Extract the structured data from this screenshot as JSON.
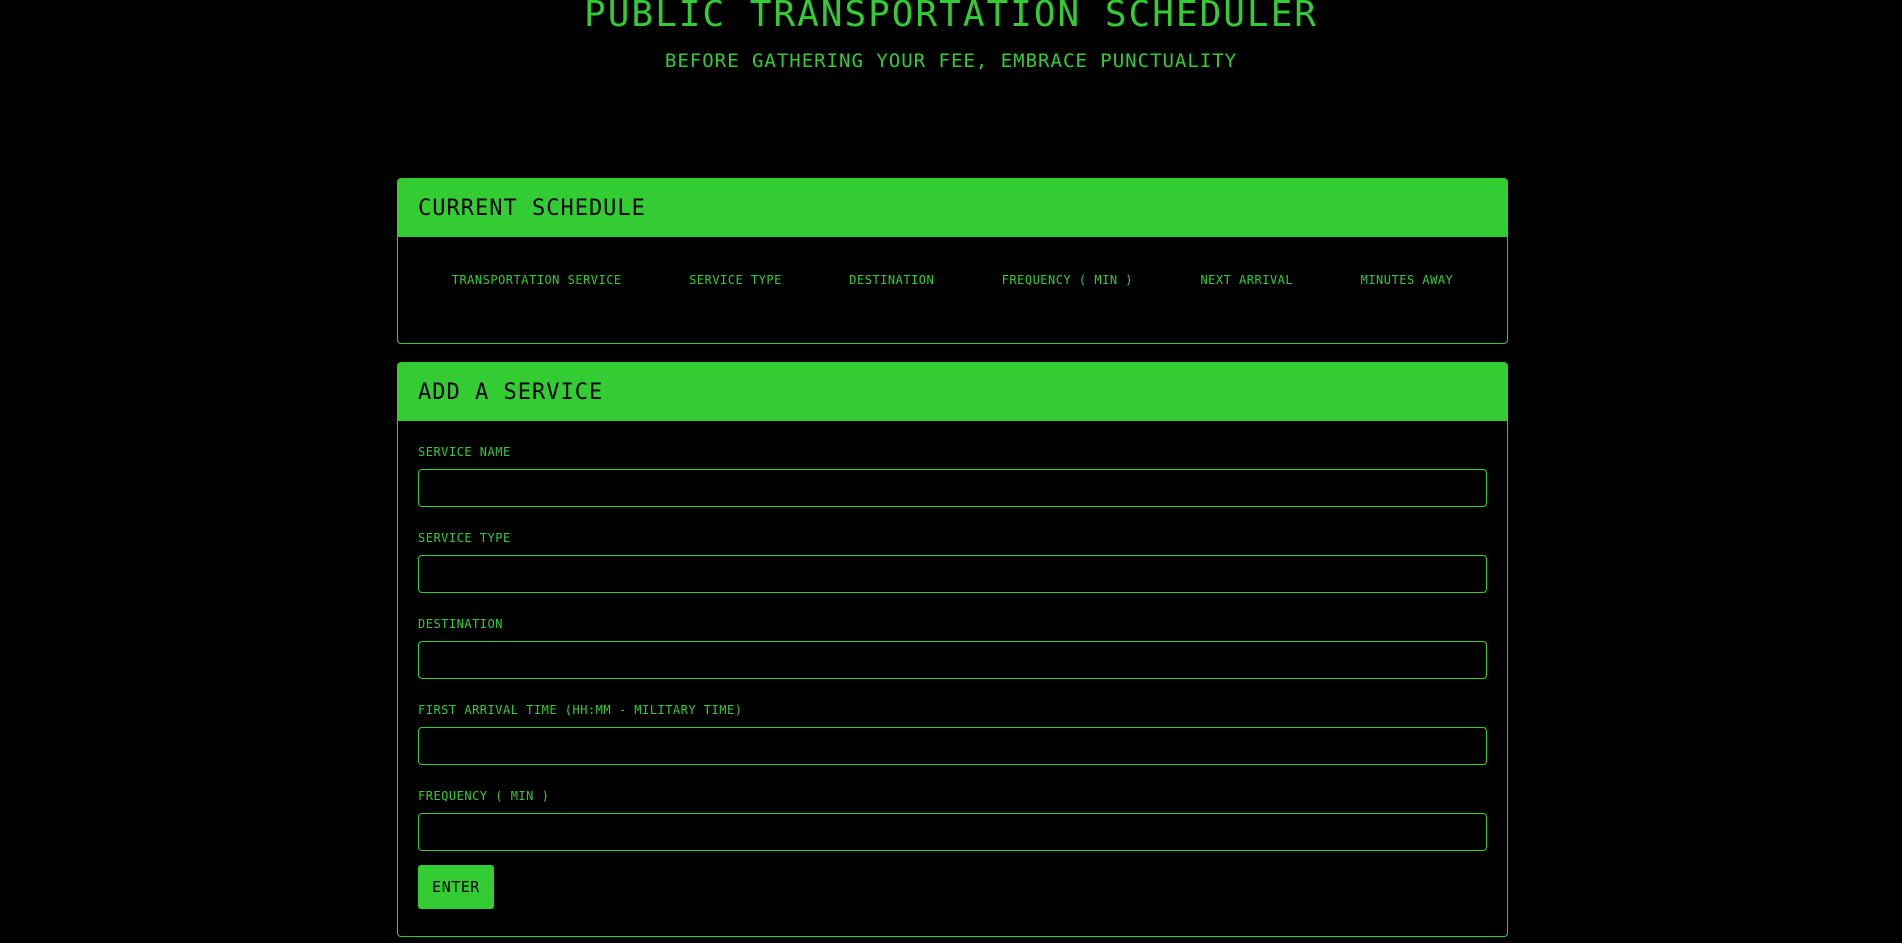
{
  "header": {
    "title": "Public Transportation Scheduler",
    "subtitle": "Before gathering your fee, embrace punctuality"
  },
  "schedule": {
    "heading": "Current Schedule",
    "columns": [
      "Transportation Service",
      "Service Type",
      "Destination",
      "Frequency ( min )",
      "Next Arrival",
      "Minutes Away"
    ]
  },
  "add_service": {
    "heading": "Add a Service",
    "fields": [
      {
        "label": "Service Name",
        "value": "",
        "placeholder": ""
      },
      {
        "label": "Service Type",
        "value": "",
        "placeholder": ""
      },
      {
        "label": "Destination",
        "value": "",
        "placeholder": ""
      },
      {
        "label": "First Arrival Time (HH:mm - military time)",
        "value": "",
        "placeholder": ""
      },
      {
        "label": "Frequency ( min )",
        "value": "",
        "placeholder": ""
      }
    ],
    "submit_label": "Enter"
  },
  "colors": {
    "accent": "#33cc33",
    "background": "#000000"
  }
}
